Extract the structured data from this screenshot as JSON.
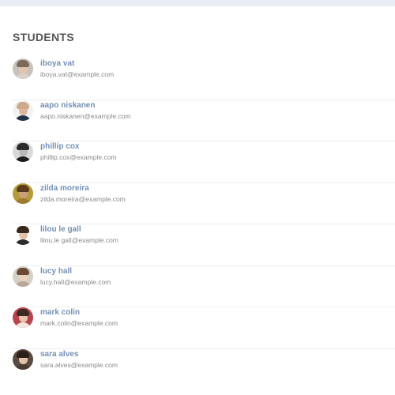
{
  "header": {
    "title": "STUDENTS"
  },
  "students": [
    {
      "name": "iboya vat",
      "email": "iboya.vat@example.com",
      "avatar": {
        "bg": "#c9c2bc",
        "face": "#e2c3ab",
        "hair": "#7b6a5a",
        "shoulders": "#d8d2cc"
      }
    },
    {
      "name": "aapo niskanen",
      "email": "aapo.niskanen@example.com",
      "avatar": {
        "bg": "#f2f2f2",
        "face": "#e0b79b",
        "hair": "#cfa98c",
        "shoulders": "#24324a"
      }
    },
    {
      "name": "phillip cox",
      "email": "phillip.cox@example.com",
      "avatar": {
        "bg": "#d9d9d9",
        "face": "#b9b9b9",
        "hair": "#2b2b2b",
        "shoulders": "#1d1d1d"
      }
    },
    {
      "name": "zilda moreira",
      "email": "zilda.moreira@example.com",
      "avatar": {
        "bg": "#b59a3a",
        "face": "#c99f7a",
        "hair": "#5a3a1e",
        "shoulders": "#9a7b32"
      }
    },
    {
      "name": "lilou le gall",
      "email": "lilou.le gall@example.com",
      "avatar": {
        "bg": "#ffffff",
        "face": "#e4c0a4",
        "hair": "#3a2a1c",
        "shoulders": "#2c2c2c"
      }
    },
    {
      "name": "lucy hall",
      "email": "lucy.hall@example.com",
      "avatar": {
        "bg": "#d6cfc7",
        "face": "#ead2bf",
        "hair": "#6a4a34",
        "shoulders": "#b9a89a"
      }
    },
    {
      "name": "mark colin",
      "email": "mark.colin@example.com",
      "avatar": {
        "bg": "#b9444f",
        "face": "#e6c4ad",
        "hair": "#3a2a22",
        "shoulders": "#f0e8e0"
      }
    },
    {
      "name": "sara alves",
      "email": "sara.alves@example.com",
      "avatar": {
        "bg": "#5a4a42",
        "face": "#e2c2a8",
        "hair": "#2a1e18",
        "shoulders": "#4a3a32"
      }
    }
  ]
}
